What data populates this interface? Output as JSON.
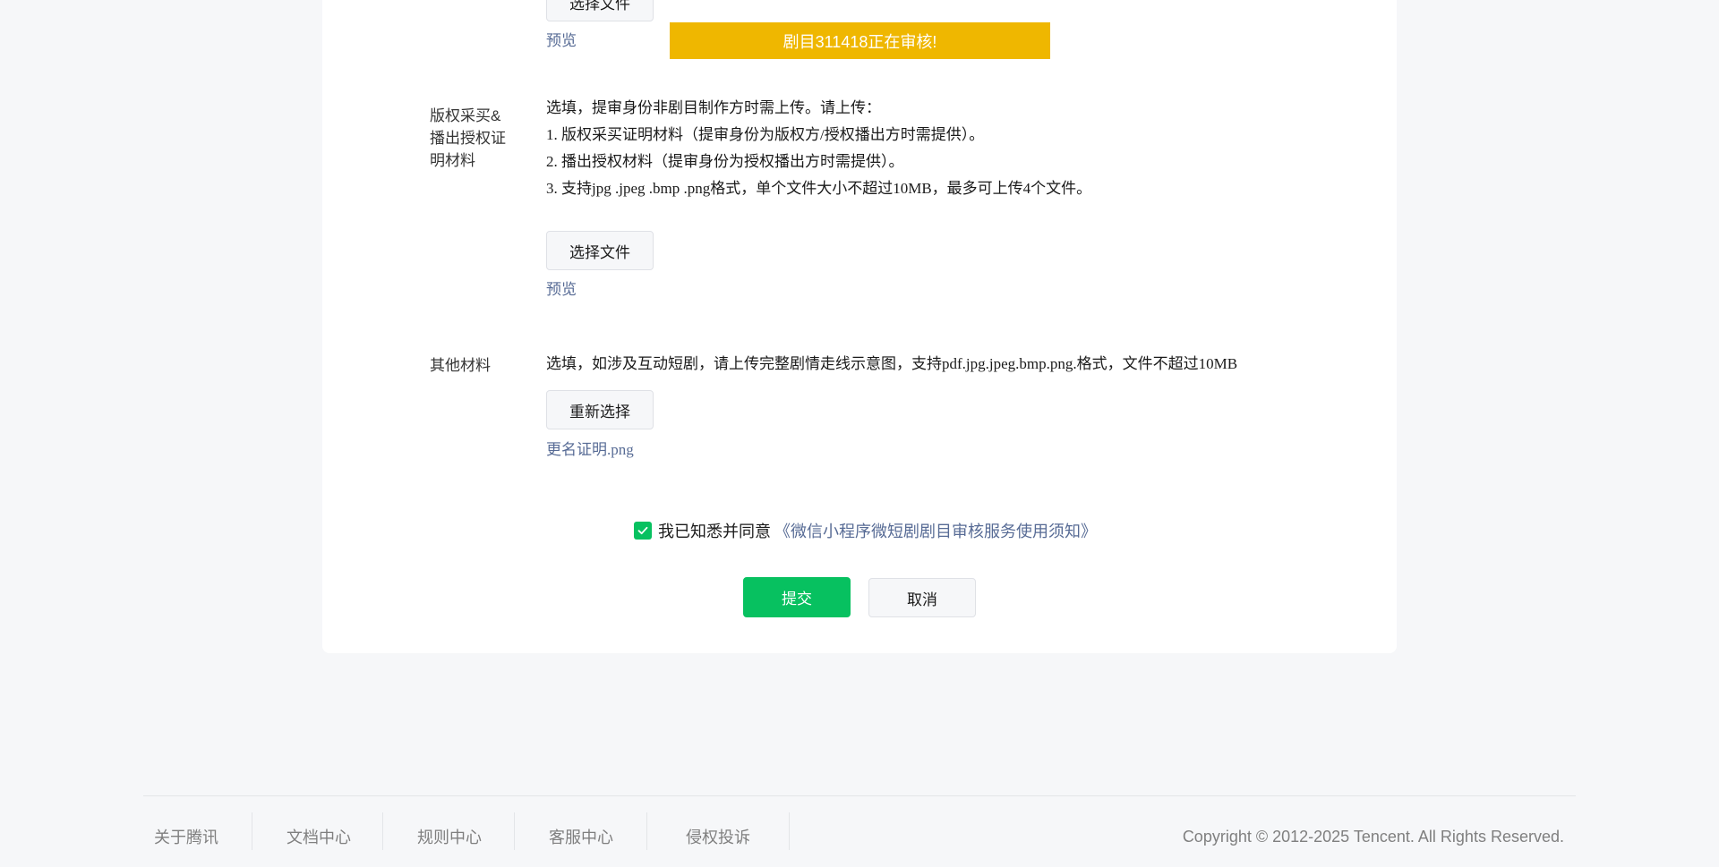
{
  "upload_section_top": {
    "choose_file_label": "选择文件",
    "preview_link": "预览",
    "status_banner": "剧目311418正在审核!"
  },
  "copyright_proof": {
    "label": "版权采买&播出授权证明材料",
    "description": [
      "选填，提审身份非剧目制作方时需上传。请上传：",
      "1. 版权采买证明材料（提审身份为版权方/授权播出方时需提供）。",
      "2. 播出授权材料（提审身份为授权播出方时需提供）。",
      "3. 支持jpg .jpeg .bmp .png格式，单个文件大小不超过10MB，最多可上传4个文件。"
    ],
    "choose_file_label": "选择文件",
    "preview_link": "预览"
  },
  "other_materials": {
    "label": "其他材料",
    "description": "选填，如涉及互动短剧，请上传完整剧情走线示意图，支持pdf.jpg.jpeg.bmp.png.格式，文件不超过10MB",
    "reselect_label": "重新选择",
    "file_name": "更名证明.png"
  },
  "agreement": {
    "checked": true,
    "text": "我已知悉并同意",
    "link": "《微信小程序微短剧剧目审核服务使用须知》"
  },
  "actions": {
    "submit_label": "提交",
    "cancel_label": "取消"
  },
  "footer": {
    "links": [
      "关于腾讯",
      "文档中心",
      "规则中心",
      "客服中心",
      "侵权投诉"
    ],
    "copyright": "Copyright © 2012-2025 Tencent. All Rights Reserved."
  },
  "colors": {
    "primary": "#07c160",
    "link": "#576b95",
    "banner": "#efb700",
    "background": "#f6f7f9"
  }
}
